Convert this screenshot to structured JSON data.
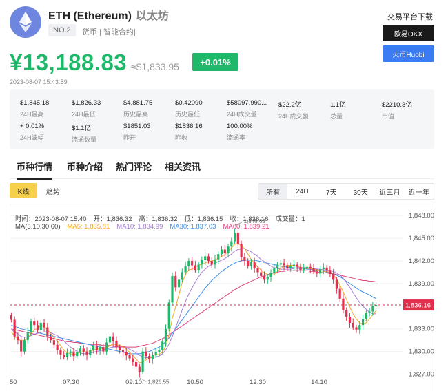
{
  "header": {
    "symbol_name": "ETH (Ethereum)",
    "cn_name": "以太坊",
    "rank": "NO.2",
    "tags": "货币 | 智能合约|",
    "download_title": "交易平台下载",
    "exchanges": [
      "欧易OKX",
      "火币Huobi"
    ],
    "price": "¥13,188.83",
    "usd_price": "≈$1,833.95",
    "change": "+0.01%",
    "timestamp": "2023-08-07 15:43:59",
    "colors": {
      "up": "#1fb86a",
      "down": "#e0304e",
      "okx": "#1a1a1a",
      "huobi": "#3b7cf5"
    }
  },
  "stats": [
    {
      "value": "$1,845.18",
      "label": "24H最高"
    },
    {
      "value": "$1,826.33",
      "label": "24H最低"
    },
    {
      "value": "$4,881.75",
      "label": "历史最高"
    },
    {
      "value": "$0.42090",
      "label": "历史最低"
    },
    {
      "value": "$58097,990...",
      "label": "24H成交量"
    },
    {
      "value": "$22.2亿",
      "label": "24H成交额"
    },
    {
      "value": "1.1亿",
      "label": "总量"
    },
    {
      "value": "$2210.3亿",
      "label": "市值"
    },
    {
      "value": "+ 0.01%",
      "label": "24H波幅"
    },
    {
      "value": "$1.1亿",
      "label": "流通数量"
    },
    {
      "value": "$1851.03",
      "label": "昨开"
    },
    {
      "value": "$1836.16",
      "label": "昨收"
    },
    {
      "value": "100.00%",
      "label": "流通率"
    }
  ],
  "tabs": [
    "币种行情",
    "币种介绍",
    "热门评论",
    "相关资讯"
  ],
  "chart_types": [
    "K线",
    "趋势"
  ],
  "ranges": [
    "所有",
    "24H",
    "7天",
    "30天",
    "近三月",
    "近一年"
  ],
  "ohlc_info": {
    "time": "时间：2023-08-07 15:40",
    "open": "开：1,836.32",
    "high": "高：1,836.32",
    "low": "低：1,836.15",
    "close": "收：1,836.16",
    "volume": "成交量：1"
  },
  "ma_info": {
    "label": "MA(5,10,30,60)",
    "ma5": "MA5: 1,835.81",
    "ma10": "MA10: 1,834.99",
    "ma30": "MA30: 1,837.03",
    "ma60": "MA60: 1,839.21",
    "colors": {
      "ma5": "#f5a623",
      "ma10": "#a77bd4",
      "ma30": "#3b8ee8",
      "ma60": "#e0407e"
    }
  },
  "chart_data": {
    "type": "candlestick",
    "y_ticks": [
      "1,848.00",
      "1,845.00",
      "1,842.00",
      "1,839.00",
      "1,836.00",
      "1,833.00",
      "1,830.00",
      "1,827.00"
    ],
    "y_tick_values": [
      1848,
      1845,
      1842,
      1839,
      1836,
      1833,
      1830,
      1827
    ],
    "x_ticks": [
      "50",
      "07:30",
      "09:10",
      "10:50",
      "12:30",
      "14:10"
    ],
    "ylim": [
      1825.5,
      1849.2
    ],
    "current_price_label": "1,836.16",
    "current_price": 1836.16,
    "max_label": "1,846.65",
    "max_value": 1846.65,
    "min_label": "1,826.55",
    "min_value": 1826.55,
    "closes": [
      1834.2,
      1832.0,
      1831.5,
      1830.0,
      1831.5,
      1832.6,
      1834.0,
      1833.5,
      1832.8,
      1833.8,
      1833.2,
      1832.0,
      1831.5,
      1830.9,
      1830.2,
      1829.6,
      1829.3,
      1829.8,
      1830.0,
      1829.4,
      1829.9,
      1830.4,
      1830.0,
      1829.5,
      1830.2,
      1830.8,
      1830.2,
      1830.6,
      1830.0,
      1831.2,
      1832.0,
      1831.4,
      1830.6,
      1830.2,
      1829.9,
      1829.5,
      1829.1,
      1828.6,
      1828.0,
      1827.3,
      1830.0,
      1829.4,
      1829.0,
      1829.5,
      1829.9,
      1830.2,
      1831.3,
      1833.0,
      1836.5,
      1840.0,
      1838.5,
      1839.5,
      1840.5,
      1841.3,
      1842.0,
      1841.4,
      1840.8,
      1841.5,
      1842.1,
      1842.6,
      1842.0,
      1841.5,
      1842.2,
      1842.9,
      1843.5,
      1843.0,
      1843.9,
      1844.6,
      1845.7,
      1844.2,
      1842.5,
      1842.0,
      1841.3,
      1841.8,
      1841.0,
      1840.5,
      1840.0,
      1839.5,
      1839.9,
      1840.4,
      1841.0,
      1841.5,
      1841.7,
      1841.4,
      1841.0,
      1841.3,
      1841.5,
      1841.2,
      1840.8,
      1841.0,
      1841.2,
      1841.0,
      1840.6,
      1840.3,
      1840.9,
      1841.1,
      1840.8,
      1840.3,
      1839.5,
      1838.3,
      1837.0,
      1835.5,
      1834.6,
      1833.8,
      1833.2,
      1832.9,
      1833.5,
      1834.3,
      1835.1,
      1835.3,
      1836.0,
      1836.16
    ],
    "ma5": [
      1832.6,
      1832.0,
      1831.7,
      1831.4,
      1831.5,
      1831.8,
      1832.4,
      1832.8,
      1833.1,
      1833.5,
      1833.3,
      1832.9,
      1832.4,
      1831.9,
      1831.4,
      1830.8,
      1830.2,
      1829.8,
      1829.7,
      1829.6,
      1829.7,
      1829.9,
      1830.0,
      1829.9,
      1830.0,
      1830.2,
      1830.3,
      1830.4,
      1830.4,
      1830.5,
      1830.8,
      1831.0,
      1830.9,
      1830.8,
      1830.7,
      1830.3,
      1829.9,
      1829.5,
      1829.0,
      1828.5,
      1828.6,
      1828.9,
      1829.1,
      1829.4,
      1829.6,
      1829.6,
      1829.9,
      1830.7,
      1832.2,
      1834.4,
      1835.9,
      1837.5,
      1839.1,
      1840.2,
      1840.8,
      1840.9,
      1841.2,
      1841.4,
      1841.6,
      1841.7,
      1841.9,
      1842.0,
      1842.1,
      1842.4,
      1842.6,
      1842.8,
      1843.3,
      1843.7,
      1844.2,
      1844.3,
      1844.0,
      1843.6,
      1842.9,
      1842.2,
      1841.7,
      1841.2,
      1840.8,
      1840.4,
      1840.2,
      1840.1,
      1840.2,
      1840.6,
      1841.0,
      1841.3,
      1841.4,
      1841.4,
      1841.4,
      1841.3,
      1841.1,
      1841.0,
      1841.0,
      1841.0,
      1840.9,
      1840.8,
      1840.7,
      1840.6,
      1840.6,
      1840.5,
      1840.2,
      1839.6,
      1838.8,
      1837.9,
      1836.9,
      1835.9,
      1835.0,
      1834.3,
      1833.8,
      1833.6,
      1833.8,
      1834.3,
      1834.9,
      1835.4
    ],
    "ma10": [
      1832.9,
      1832.6,
      1832.3,
      1832.0,
      1831.9,
      1831.9,
      1832.1,
      1832.3,
      1832.4,
      1832.5,
      1832.6,
      1832.6,
      1832.5,
      1832.3,
      1832.1,
      1831.8,
      1831.4,
      1831.0,
      1830.6,
      1830.3,
      1830.0,
      1829.8,
      1829.7,
      1829.7,
      1829.8,
      1829.9,
      1830.0,
      1830.1,
      1830.2,
      1830.4,
      1830.5,
      1830.6,
      1830.6,
      1830.6,
      1830.6,
      1830.5,
      1830.3,
      1830.1,
      1829.8,
      1829.5,
      1829.3,
      1829.2,
      1829.2,
      1829.2,
      1829.3,
      1829.4,
      1829.7,
      1830.2,
      1831.0,
      1832.0,
      1833.2,
      1834.3,
      1835.5,
      1836.6,
      1837.6,
      1838.4,
      1839.2,
      1839.9,
      1840.5,
      1840.9,
      1841.3,
      1841.5,
      1841.7,
      1841.9,
      1842.1,
      1842.3,
      1842.6,
      1842.9,
      1843.3,
      1843.5,
      1843.6,
      1843.6,
      1843.4,
      1843.2,
      1842.9,
      1842.6,
      1842.2,
      1841.9,
      1841.6,
      1841.3,
      1841.1,
      1841.0,
      1840.9,
      1840.9,
      1840.9,
      1840.9,
      1841.0,
      1841.1,
      1841.1,
      1841.1,
      1841.1,
      1841.0,
      1841.0,
      1840.9,
      1840.9,
      1840.8,
      1840.8,
      1840.7,
      1840.6,
      1840.4,
      1840.1,
      1839.7,
      1839.1,
      1838.5,
      1837.8,
      1837.1,
      1836.5,
      1836.0,
      1835.6,
      1835.2,
      1835.0,
      1834.99
    ],
    "ma30": [
      1833.5,
      1833.3,
      1833.2,
      1833.0,
      1832.9,
      1832.8,
      1832.7,
      1832.6,
      1832.5,
      1832.4,
      1832.3,
      1832.2,
      1832.1,
      1832.0,
      1831.9,
      1831.8,
      1831.7,
      1831.6,
      1831.5,
      1831.4,
      1831.3,
      1831.2,
      1831.1,
      1831.0,
      1830.9,
      1830.8,
      1830.7,
      1830.6,
      1830.5,
      1830.4,
      1830.3,
      1830.2,
      1830.1,
      1830.0,
      1829.9,
      1829.8,
      1829.7,
      1829.7,
      1829.7,
      1829.7,
      1829.8,
      1829.9,
      1830.0,
      1830.2,
      1830.4,
      1830.6,
      1830.9,
      1831.3,
      1831.8,
      1832.4,
      1833.0,
      1833.6,
      1834.2,
      1834.8,
      1835.4,
      1836.0,
      1836.6,
      1837.2,
      1837.8,
      1838.4,
      1838.9,
      1839.4,
      1839.8,
      1840.2,
      1840.6,
      1840.9,
      1841.2,
      1841.5,
      1841.7,
      1841.9,
      1842.0,
      1842.1,
      1842.1,
      1842.1,
      1842.1,
      1842.0,
      1841.9,
      1841.8,
      1841.7,
      1841.6,
      1841.5,
      1841.4,
      1841.3,
      1841.2,
      1841.2,
      1841.1,
      1841.1,
      1841.0,
      1841.0,
      1841.0,
      1840.9,
      1840.9,
      1840.8,
      1840.8,
      1840.7,
      1840.6,
      1840.5,
      1840.4,
      1840.3,
      1840.1,
      1839.9,
      1839.6,
      1839.3,
      1839.0,
      1838.7,
      1838.4,
      1838.1,
      1837.9,
      1837.7,
      1837.5,
      1837.2,
      1837.03
    ],
    "ma60": [
      1833.0,
      1832.9,
      1832.8,
      1832.7,
      1832.6,
      1832.5,
      1832.4,
      1832.3,
      1832.2,
      1832.1,
      1832.0,
      1831.9,
      1831.8,
      1831.7,
      1831.6,
      1831.5,
      1831.4,
      1831.3,
      1831.3,
      1831.2,
      1831.2,
      1831.1,
      1831.1,
      1831.0,
      1831.0,
      1830.9,
      1830.9,
      1830.9,
      1830.8,
      1830.8,
      1830.8,
      1830.7,
      1830.7,
      1830.7,
      1830.7,
      1830.6,
      1830.6,
      1830.6,
      1830.6,
      1830.7,
      1830.8,
      1830.9,
      1831.0,
      1831.1,
      1831.3,
      1831.5,
      1831.7,
      1831.9,
      1832.2,
      1832.5,
      1832.8,
      1833.1,
      1833.4,
      1833.7,
      1834.0,
      1834.3,
      1834.6,
      1834.9,
      1835.2,
      1835.5,
      1835.8,
      1836.1,
      1836.4,
      1836.7,
      1837.0,
      1837.3,
      1837.6,
      1837.9,
      1838.2,
      1838.4,
      1838.7,
      1838.9,
      1839.1,
      1839.3,
      1839.5,
      1839.7,
      1839.9,
      1840.0,
      1840.2,
      1840.3,
      1840.4,
      1840.5,
      1840.6,
      1840.6,
      1840.7,
      1840.7,
      1840.7,
      1840.7,
      1840.7,
      1840.7,
      1840.7,
      1840.6,
      1840.6,
      1840.5,
      1840.5,
      1840.4,
      1840.4,
      1840.3,
      1840.3,
      1840.2,
      1840.1,
      1840.0,
      1839.9,
      1839.8,
      1839.7,
      1839.6,
      1839.5,
      1839.4,
      1839.4,
      1839.3,
      1839.3,
      1839.21
    ]
  }
}
